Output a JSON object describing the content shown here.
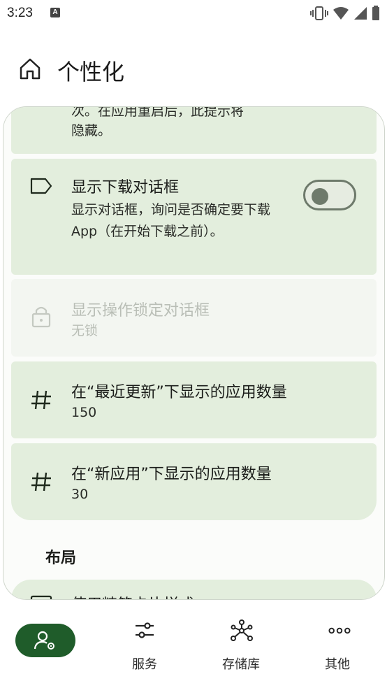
{
  "status_bar": {
    "time": "3:23",
    "notif_letter": "A"
  },
  "header": {
    "title": "个性化"
  },
  "cards": [
    {
      "sub_line1": "次。在应用重启后，此提示将",
      "sub_line2": "隐藏。"
    },
    {
      "title": "显示下载对话框",
      "sub": "显示对话框，询问是否确定要下载 App（在开始下载之前）。",
      "toggle_on": false
    },
    {
      "title": "显示操作锁定对话框",
      "sub": "无锁",
      "disabled": true
    },
    {
      "title": "在“最近更新”下显示的应用数量",
      "sub": "150"
    },
    {
      "title": "在“新应用”下显示的应用数量",
      "sub": "30"
    }
  ],
  "sections": {
    "layout": "布局",
    "layout_next_partial": "使用精简卡片样式"
  },
  "bottom_nav": {
    "items": [
      {
        "label": "",
        "icon": "user-settings-icon",
        "active": true
      },
      {
        "label": "服务",
        "icon": "sliders-icon"
      },
      {
        "label": "存储库",
        "icon": "hub-icon"
      },
      {
        "label": "其他",
        "icon": "more-horiz-icon"
      }
    ]
  },
  "colors": {
    "card_bg": "#e3eedd",
    "accent": "#1f5c2a",
    "toggle_outline": "#6e7a6b"
  }
}
